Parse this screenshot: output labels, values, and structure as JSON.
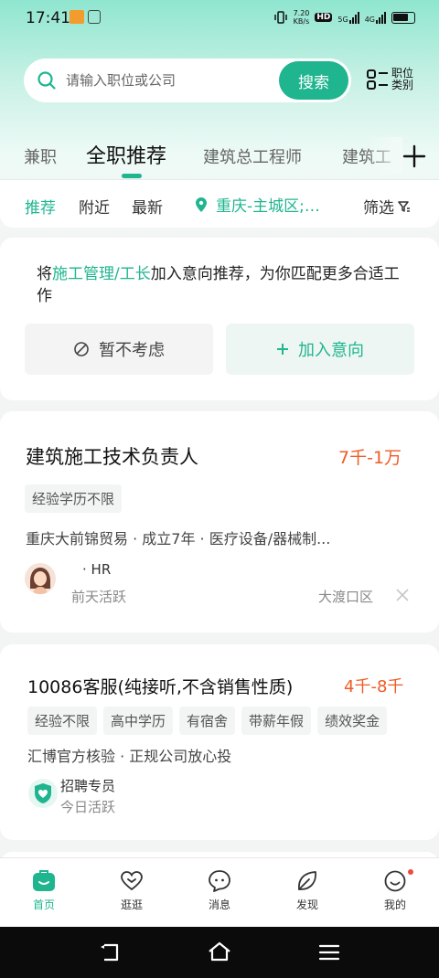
{
  "status_bar": {
    "time": "17:41",
    "net_speed_value": "7.20",
    "net_speed_unit": "KB/s",
    "hd_label": "HD",
    "network_5g": "5G",
    "network_4g": "4G"
  },
  "search": {
    "placeholder": "请输入职位或公司",
    "button_label": "搜索",
    "category_label": "职位类别"
  },
  "tabs": [
    {
      "label": "兼职"
    },
    {
      "label": "全职推荐",
      "active": true
    },
    {
      "label": "建筑总工程师"
    },
    {
      "label": "建筑工"
    }
  ],
  "filters": {
    "items": [
      "推荐",
      "附近",
      "最新"
    ],
    "location": "重庆-主城区;…",
    "screen_label": "筛选"
  },
  "intent_card": {
    "prefix": "将",
    "highlight": "施工管理/工长",
    "suffix": "加入意向推荐，为你匹配更多合适工作",
    "skip_label": "暂不考虑",
    "add_label": "加入意向"
  },
  "jobs": [
    {
      "title": "建筑施工技术负责人",
      "salary": "7千-1万",
      "tags": [
        "经验学历不限"
      ],
      "company_line": "重庆大前锦贸易 · 成立7年 · 医疗设备/器械制...",
      "hr_name": "· HR",
      "active": "前天活跃",
      "location": "大渡口区"
    },
    {
      "title": "10086客服(纯接听,不含销售性质)",
      "salary": "4千-8千",
      "tags": [
        "经验不限",
        "高中学历",
        "有宿舍",
        "带薪年假",
        "绩效奖金"
      ],
      "company_line": "汇博官方核验 · 正规公司放心投",
      "hr_name": "招聘专员",
      "active": "今日活跃"
    }
  ],
  "bottom_nav": [
    {
      "label": "首页",
      "icon": "home-icon",
      "active": true
    },
    {
      "label": "逛逛",
      "icon": "heart-icon"
    },
    {
      "label": "消息",
      "icon": "message-icon"
    },
    {
      "label": "发现",
      "icon": "discover-icon"
    },
    {
      "label": "我的",
      "icon": "profile-icon"
    }
  ],
  "colors": {
    "accent": "#1fb58f",
    "salary": "#f05b25"
  }
}
